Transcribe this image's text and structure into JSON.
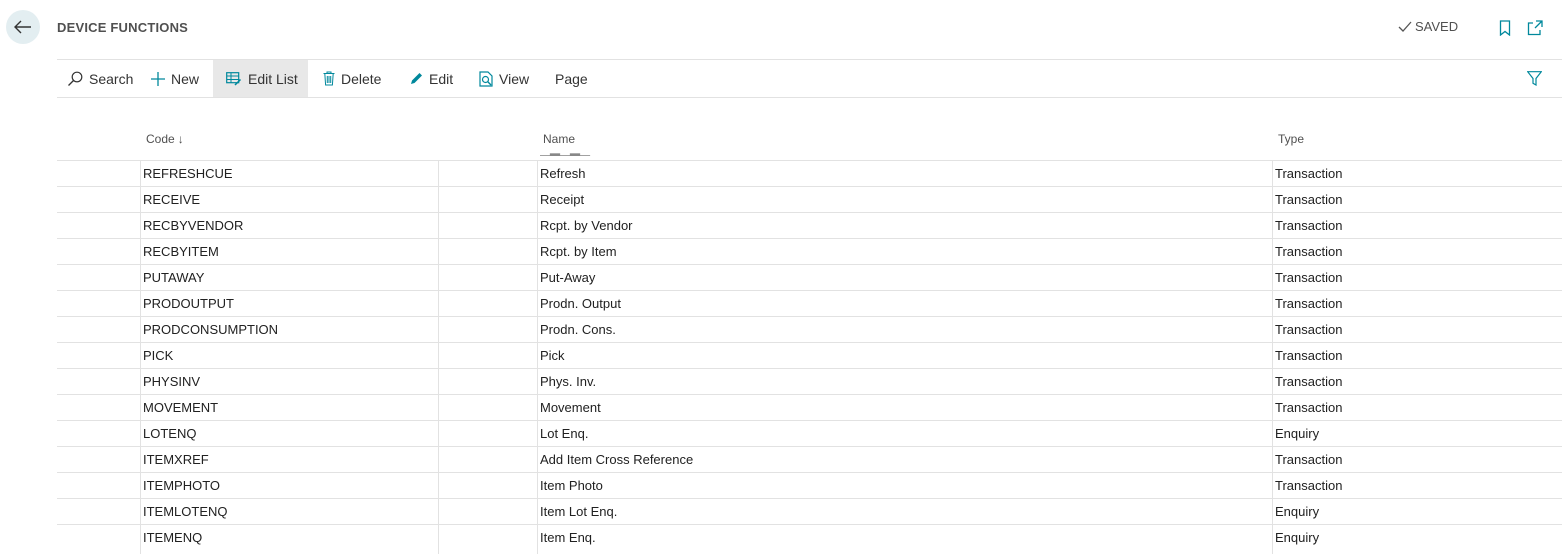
{
  "header": {
    "title": "DEVICE FUNCTIONS",
    "status": "SAVED",
    "icons": [
      "back-arrow-icon",
      "checkmark-icon",
      "bookmark-icon",
      "open-new-window-icon"
    ]
  },
  "toolbar": {
    "search": "Search",
    "new": "New",
    "edit_list": "Edit List",
    "delete": "Delete",
    "edit": "Edit",
    "view": "View",
    "page": "Page"
  },
  "columns": {
    "code": "Code",
    "code_sort": "↓",
    "name": "Name",
    "type": "Type"
  },
  "rows": [
    {
      "code": "REFRESHCUE",
      "name": "Refresh",
      "type": "Transaction"
    },
    {
      "code": "RECEIVE",
      "name": "Receipt",
      "type": "Transaction"
    },
    {
      "code": "RECBYVENDOR",
      "name": "Rcpt. by Vendor",
      "type": "Transaction"
    },
    {
      "code": "RECBYITEM",
      "name": "Rcpt. by Item",
      "type": "Transaction"
    },
    {
      "code": "PUTAWAY",
      "name": "Put-Away",
      "type": "Transaction"
    },
    {
      "code": "PRODOUTPUT",
      "name": "Prodn. Output",
      "type": "Transaction"
    },
    {
      "code": "PRODCONSUMPTION",
      "name": "Prodn. Cons.",
      "type": "Transaction"
    },
    {
      "code": "PICK",
      "name": "Pick",
      "type": "Transaction"
    },
    {
      "code": "PHYSINV",
      "name": "Phys. Inv.",
      "type": "Transaction"
    },
    {
      "code": "MOVEMENT",
      "name": "Movement",
      "type": "Transaction"
    },
    {
      "code": "LOTENQ",
      "name": "Lot Enq.",
      "type": "Enquiry"
    },
    {
      "code": "ITEMXREF",
      "name": "Add Item Cross Reference",
      "type": "Transaction"
    },
    {
      "code": "ITEMPHOTO",
      "name": "Item Photo",
      "type": "Transaction"
    },
    {
      "code": "ITEMLOTENQ",
      "name": "Item Lot Enq.",
      "type": "Enquiry"
    },
    {
      "code": "ITEMENQ",
      "name": "Item Enq.",
      "type": "Enquiry"
    }
  ],
  "colors": {
    "accent": "#00889c",
    "back_button_bg": "#e3eef1",
    "active_toolbar_bg": "#e8e8e8",
    "grid_line": "#e2e2e2"
  }
}
